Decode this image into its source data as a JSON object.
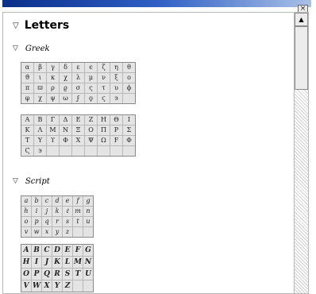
{
  "window": {
    "close_glyph": "×"
  },
  "section": {
    "title": "Letters"
  },
  "greek": {
    "title": "Greek",
    "lower": [
      "α",
      "β",
      "γ",
      "δ",
      "ε",
      "ϵ",
      "ζ",
      "η",
      "θ",
      "ϑ",
      "ι",
      "κ",
      "χ",
      "λ",
      "μ",
      "ν",
      "ξ",
      "ο",
      "π",
      "ϖ",
      "ρ",
      "ϱ",
      "σ",
      "ς",
      "τ",
      "υ",
      "ϕ",
      "φ",
      "χ",
      "ψ",
      "ω",
      "ϝ",
      "ϙ",
      "ϛ",
      "϶",
      ""
    ],
    "upper": [
      "Α",
      "Β",
      "Γ",
      "Δ",
      "Ε",
      "Ζ",
      "Η",
      "Θ",
      "Ι",
      "Κ",
      "Λ",
      "Μ",
      "Ν",
      "Ξ",
      "Ο",
      "Π",
      "Ρ",
      "Σ",
      "Τ",
      "Υ",
      "ϒ",
      "Φ",
      "Χ",
      "Ψ",
      "Ω",
      "Ϝ",
      "Φ",
      "Ϛ",
      "϶",
      "",
      "",
      "",
      "",
      "",
      "",
      ""
    ]
  },
  "script": {
    "title": "Script",
    "lower": [
      "a",
      "b",
      "c",
      "d",
      "e",
      "f",
      "g",
      "h",
      "i",
      "j",
      "k",
      "ℓ",
      "m",
      "n",
      "o",
      "p",
      "q",
      "r",
      "s",
      "t",
      "u",
      "v",
      "w",
      "x",
      "y",
      "z",
      "",
      ""
    ],
    "upper": [
      "A",
      "B",
      "C",
      "D",
      "E",
      "F",
      "G",
      "H",
      "I",
      "J",
      "K",
      "L",
      "M",
      "N",
      "O",
      "P",
      "Q",
      "R",
      "S",
      "T",
      "U",
      "V",
      "W",
      "X",
      "Y",
      "Z",
      "",
      ""
    ]
  },
  "icons": {
    "collapse": "▽",
    "scroll_up": "▲"
  }
}
